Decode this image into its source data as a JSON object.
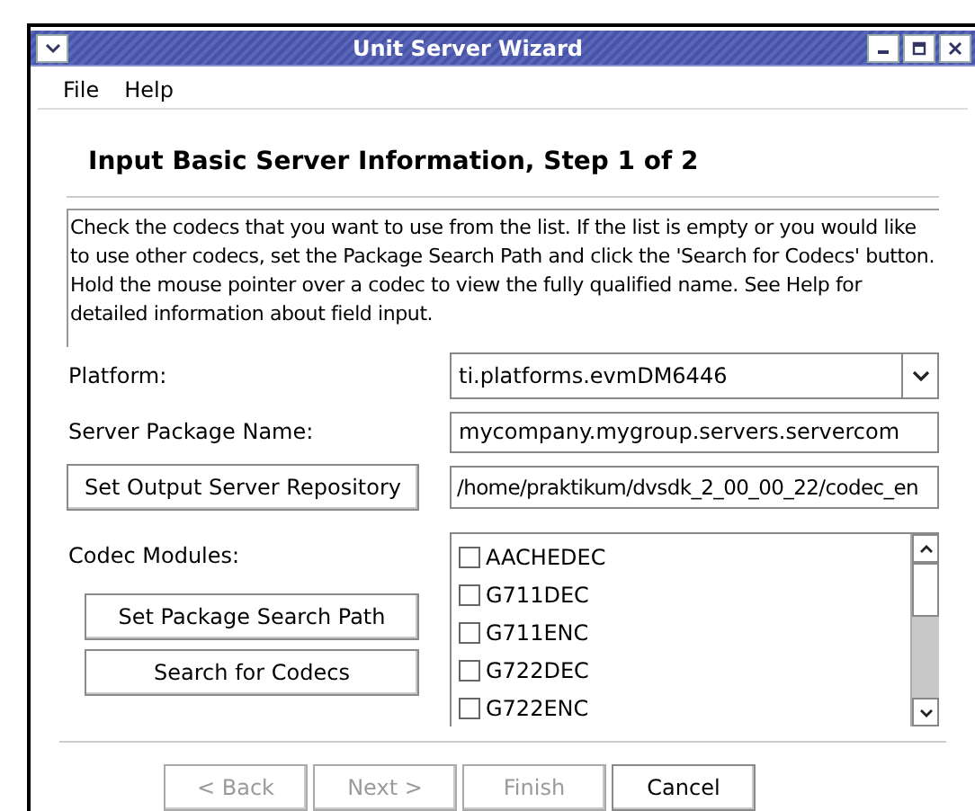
{
  "window": {
    "title": "Unit Server Wizard"
  },
  "menu": [
    "File",
    "Help"
  ],
  "heading": "Input Basic Server Information, Step 1 of 2",
  "description": "Check the codecs that you want to use from the list. If the list is empty or you would like to use other codecs, set the Package Search Path and click the 'Search for Codecs' button. Hold the mouse pointer over a codec to view the fully qualified name. See Help for detailed information about field input.",
  "platform": {
    "label": "Platform:",
    "value": "ti.platforms.evmDM6446"
  },
  "package_name": {
    "label": "Server Package Name:",
    "value": "mycompany.mygroup.servers.servercom"
  },
  "repository": {
    "button": "Set Output Server Repository",
    "value": "/home/praktikum/dvsdk_2_00_00_22/codec_en"
  },
  "codec_modules": {
    "label": "Codec Modules:",
    "buttons": [
      "Set Package Search Path",
      "Search for Codecs"
    ],
    "items": [
      {
        "name": "AACHEDEC",
        "checked": false
      },
      {
        "name": "G711DEC",
        "checked": false
      },
      {
        "name": "G711ENC",
        "checked": false
      },
      {
        "name": "G722DEC",
        "checked": false
      },
      {
        "name": "G722ENC",
        "checked": false
      }
    ]
  },
  "buttons": [
    {
      "label": "< Back",
      "disabled": true
    },
    {
      "label": "Next >",
      "disabled": true
    },
    {
      "label": "Finish",
      "disabled": true
    },
    {
      "label": "Cancel",
      "disabled": false
    }
  ]
}
